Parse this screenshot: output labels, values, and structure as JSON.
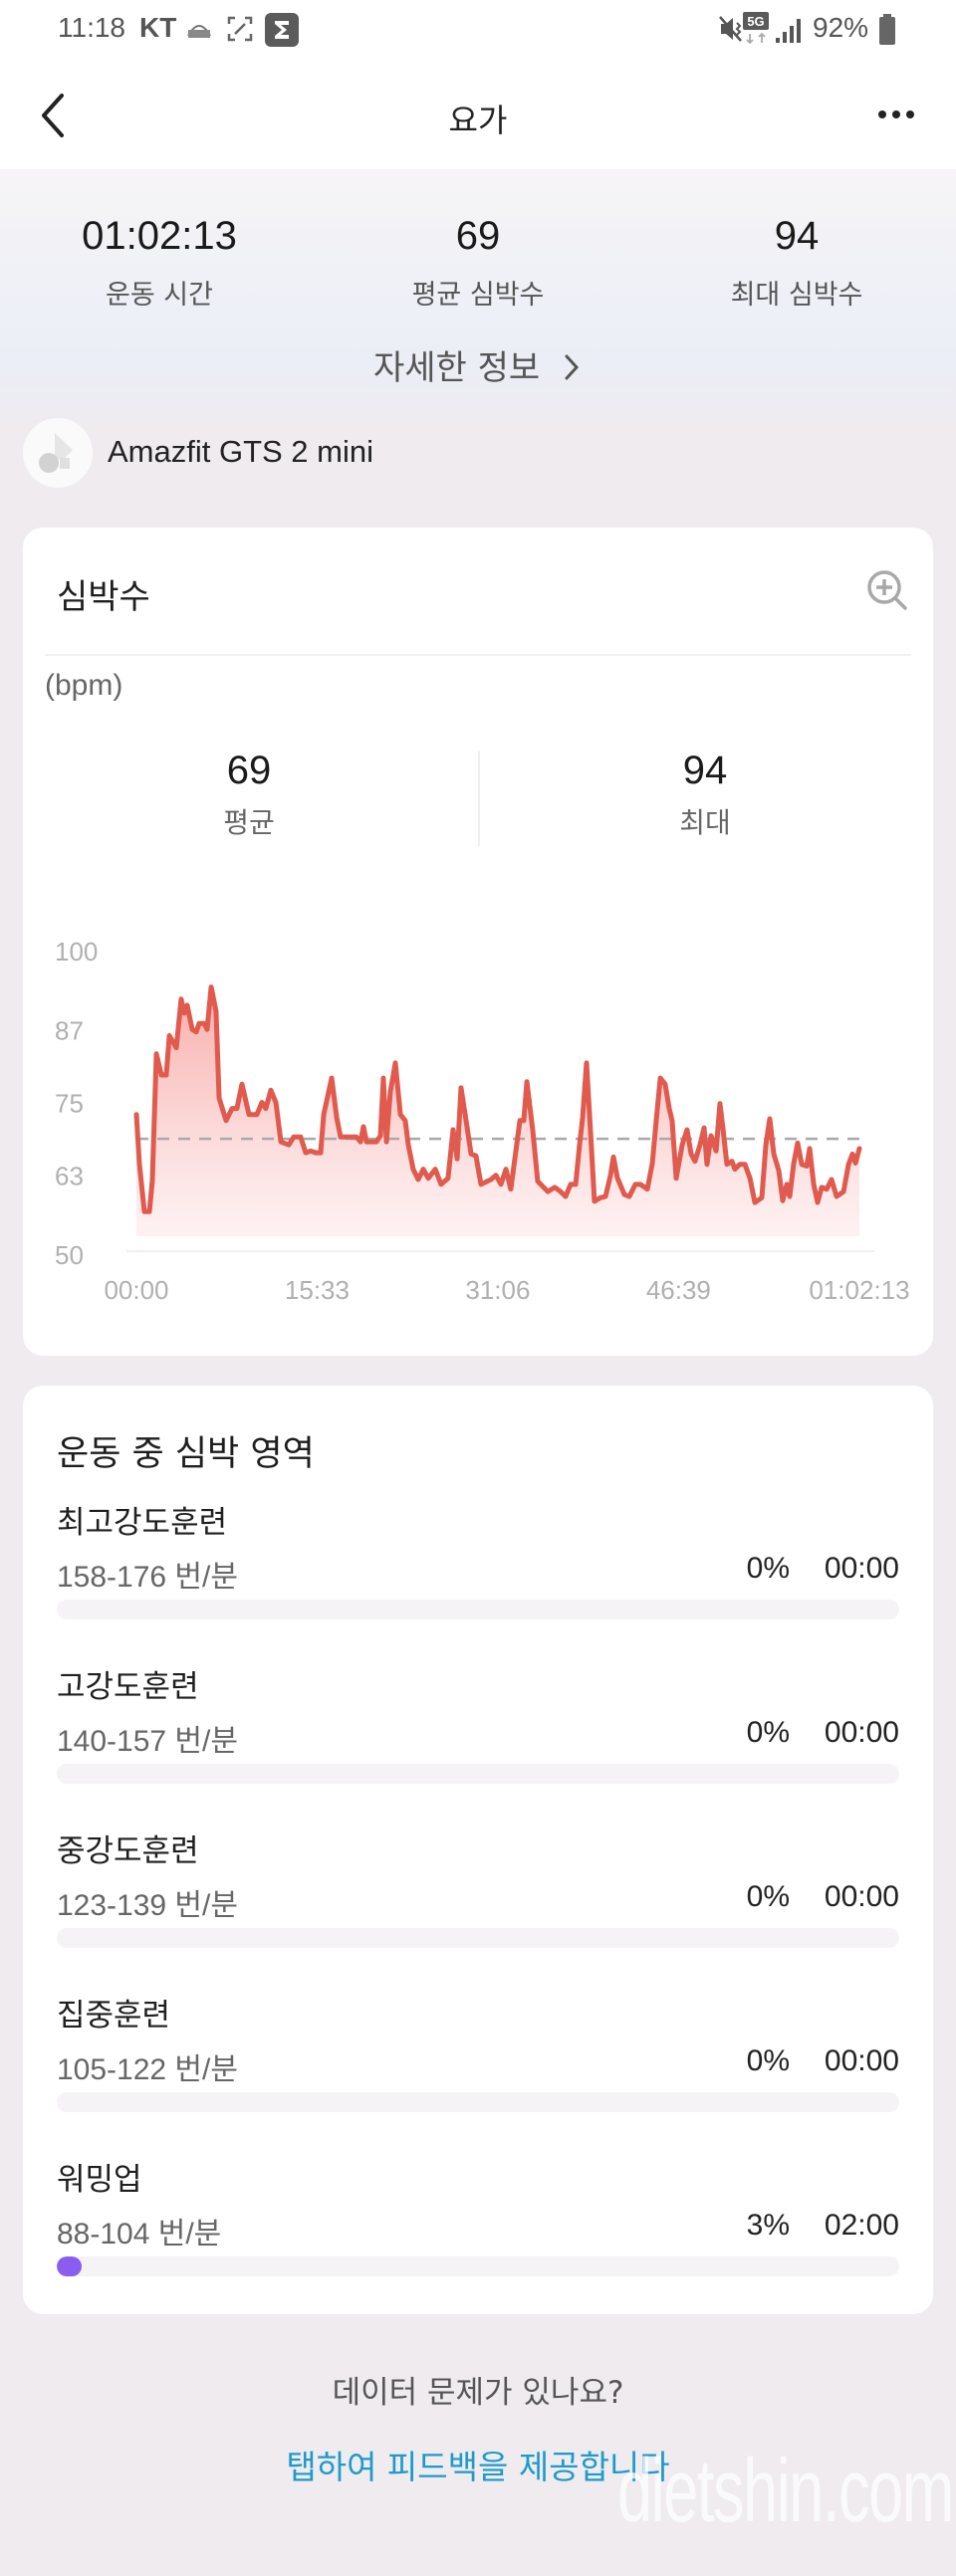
{
  "status_bar": {
    "time": "11:18",
    "carrier": "KT",
    "notification_icons": [
      "dashin-app-icon",
      "screenshot-icon",
      "sigma-app-icon"
    ],
    "system_icons": [
      "mute-vibrate-icon",
      "5g-icon",
      "signal-icon"
    ],
    "battery_percent": "92%",
    "battery_level": 0.92
  },
  "app_bar": {
    "title": "요가",
    "back_icon": "chevron-left-icon",
    "more_icon": "more-horizontal-icon"
  },
  "summary": {
    "items": [
      {
        "value": "01:02:13",
        "label": "운동 시간"
      },
      {
        "value": "69",
        "label": "평균 심박수"
      },
      {
        "value": "94",
        "label": "최대 심박수"
      }
    ],
    "details_link": "자세한 정보",
    "details_icon": "chevron-right-icon"
  },
  "device": {
    "name": "Amazfit GTS 2 mini",
    "icon": "device-app-icon"
  },
  "heart_rate_card": {
    "title": "심박수",
    "zoom_icon": "zoom-in-icon",
    "unit": "(bpm)",
    "stats": [
      {
        "value": "69",
        "label": "평균"
      },
      {
        "value": "94",
        "label": "최대"
      }
    ]
  },
  "chart_data": {
    "type": "area",
    "title": "심박수",
    "ylabel": "(bpm)",
    "xlabel": "",
    "x_unit": "seconds",
    "xlim": [
      0,
      3733
    ],
    "ylim": [
      50,
      100
    ],
    "y_ticks": [
      100,
      87,
      75,
      63,
      50
    ],
    "x_tick_labels": [
      "00:00",
      "15:33",
      "31:06",
      "46:39",
      "01:02:13"
    ],
    "x_tick_values": [
      0,
      933,
      1866,
      2799,
      3733
    ],
    "reference_line": {
      "label": "평균",
      "value": 69,
      "style": "dashed"
    },
    "grid": false,
    "line_color": "#e05a4e",
    "fill_color": "#f7a8a4",
    "series": [
      {
        "name": "심박수",
        "points": [
          [
            0,
            73
          ],
          [
            15,
            65
          ],
          [
            41,
            57
          ],
          [
            67,
            57
          ],
          [
            82,
            62
          ],
          [
            103,
            83
          ],
          [
            129,
            79.5
          ],
          [
            154,
            79.5
          ],
          [
            170,
            86
          ],
          [
            206,
            84
          ],
          [
            231,
            92
          ],
          [
            247,
            89.7
          ],
          [
            262,
            91
          ],
          [
            288,
            87
          ],
          [
            309,
            86.6
          ],
          [
            324,
            88
          ],
          [
            350,
            88
          ],
          [
            365,
            87
          ],
          [
            386,
            94
          ],
          [
            411,
            90
          ],
          [
            427,
            75.7
          ],
          [
            463,
            72
          ],
          [
            494,
            74
          ],
          [
            519,
            74
          ],
          [
            545,
            78
          ],
          [
            581,
            73
          ],
          [
            596,
            73
          ],
          [
            622,
            73
          ],
          [
            648,
            75
          ],
          [
            668,
            74
          ],
          [
            694,
            77
          ],
          [
            720,
            75
          ],
          [
            746,
            68.5
          ],
          [
            787,
            68
          ],
          [
            812,
            69.3
          ],
          [
            848,
            69.3
          ],
          [
            874,
            66.7
          ],
          [
            900,
            67
          ],
          [
            926,
            66.7
          ],
          [
            951,
            66.7
          ],
          [
            967,
            73
          ],
          [
            1008,
            79
          ],
          [
            1034,
            72.5
          ],
          [
            1054,
            69.3
          ],
          [
            1136,
            69.3
          ],
          [
            1157,
            68.5
          ],
          [
            1172,
            71
          ],
          [
            1188,
            68.5
          ],
          [
            1239,
            68.5
          ],
          [
            1260,
            69.5
          ],
          [
            1275,
            79
          ],
          [
            1291,
            68.5
          ],
          [
            1311,
            76.7
          ],
          [
            1337,
            81.5
          ],
          [
            1363,
            73
          ],
          [
            1388,
            72
          ],
          [
            1404,
            68
          ],
          [
            1429,
            64
          ],
          [
            1455,
            62.3
          ],
          [
            1481,
            64
          ],
          [
            1507,
            62.5
          ],
          [
            1543,
            64
          ],
          [
            1573,
            61.5
          ],
          [
            1609,
            62.5
          ],
          [
            1635,
            70.5
          ],
          [
            1656,
            65.7
          ],
          [
            1676,
            77.4
          ],
          [
            1702,
            72
          ],
          [
            1728,
            66.5
          ],
          [
            1753,
            66.2
          ],
          [
            1779,
            61.5
          ],
          [
            1831,
            62.3
          ],
          [
            1856,
            63
          ],
          [
            1882,
            61.5
          ],
          [
            1908,
            64
          ],
          [
            1933,
            60.7
          ],
          [
            1980,
            72
          ],
          [
            2000,
            72
          ],
          [
            2016,
            78.4
          ],
          [
            2046,
            70.5
          ],
          [
            2072,
            62
          ],
          [
            2124,
            60.3
          ],
          [
            2160,
            61
          ],
          [
            2190,
            60.3
          ],
          [
            2216,
            59.5
          ],
          [
            2242,
            61.5
          ],
          [
            2268,
            61.5
          ],
          [
            2288,
            68
          ],
          [
            2304,
            72.5
          ],
          [
            2324,
            81.5
          ],
          [
            2345,
            70
          ],
          [
            2365,
            58.7
          ],
          [
            2396,
            59.3
          ],
          [
            2422,
            59.5
          ],
          [
            2448,
            63
          ],
          [
            2463,
            66
          ],
          [
            2484,
            62.5
          ],
          [
            2520,
            59.8
          ],
          [
            2545,
            59.5
          ],
          [
            2576,
            61.5
          ],
          [
            2602,
            61.5
          ],
          [
            2638,
            60.7
          ],
          [
            2664,
            65
          ],
          [
            2684,
            72
          ],
          [
            2705,
            79
          ],
          [
            2730,
            78
          ],
          [
            2751,
            74
          ],
          [
            2766,
            72
          ],
          [
            2787,
            62.5
          ],
          [
            2818,
            68
          ],
          [
            2843,
            70.5
          ],
          [
            2864,
            66.5
          ],
          [
            2884,
            65.3
          ],
          [
            2910,
            68
          ],
          [
            2931,
            70.8
          ],
          [
            2946,
            64.8
          ],
          [
            2967,
            69.5
          ],
          [
            2993,
            67
          ],
          [
            3013,
            74.8
          ],
          [
            3029,
            70.5
          ],
          [
            3049,
            64.8
          ],
          [
            3075,
            65.3
          ],
          [
            3090,
            64
          ],
          [
            3116,
            64.8
          ],
          [
            3142,
            64.8
          ],
          [
            3168,
            62.5
          ],
          [
            3193,
            58.5
          ],
          [
            3229,
            59.3
          ],
          [
            3250,
            68
          ],
          [
            3270,
            72.3
          ],
          [
            3291,
            66.5
          ],
          [
            3317,
            63.7
          ],
          [
            3337,
            58.8
          ],
          [
            3358,
            61.5
          ],
          [
            3373,
            59.5
          ],
          [
            3394,
            65
          ],
          [
            3414,
            68.3
          ],
          [
            3435,
            64.8
          ],
          [
            3461,
            64.5
          ],
          [
            3476,
            67.4
          ],
          [
            3497,
            61.5
          ],
          [
            3517,
            58.5
          ],
          [
            3538,
            61
          ],
          [
            3564,
            60.7
          ],
          [
            3589,
            62.3
          ],
          [
            3615,
            59.5
          ],
          [
            3651,
            60.3
          ],
          [
            3677,
            64.8
          ],
          [
            3697,
            66.5
          ],
          [
            3713,
            65
          ],
          [
            3733,
            67.4
          ]
        ]
      }
    ]
  },
  "zones_card": {
    "title": "운동 중 심박 영역",
    "zones": [
      {
        "name": "최고강도훈련",
        "range": "158-176 번/분",
        "percent": "0%",
        "time": "00:00",
        "fraction": 0
      },
      {
        "name": "고강도훈련",
        "range": "140-157 번/분",
        "percent": "0%",
        "time": "00:00",
        "fraction": 0
      },
      {
        "name": "중강도훈련",
        "range": "123-139 번/분",
        "percent": "0%",
        "time": "00:00",
        "fraction": 0
      },
      {
        "name": "집중훈련",
        "range": "105-122 번/분",
        "percent": "0%",
        "time": "00:00",
        "fraction": 0
      },
      {
        "name": "워밍업",
        "range": "88-104 번/분",
        "percent": "3%",
        "time": "02:00",
        "fraction": 0.03
      }
    ],
    "bar_color": "#8b5cf0"
  },
  "footer": {
    "question": "데이터 문제가 있나요?",
    "feedback_link": "탭하여 피드백을 제공합니다",
    "link_color": "#1e9bc8"
  },
  "watermark": "dietshin.com"
}
